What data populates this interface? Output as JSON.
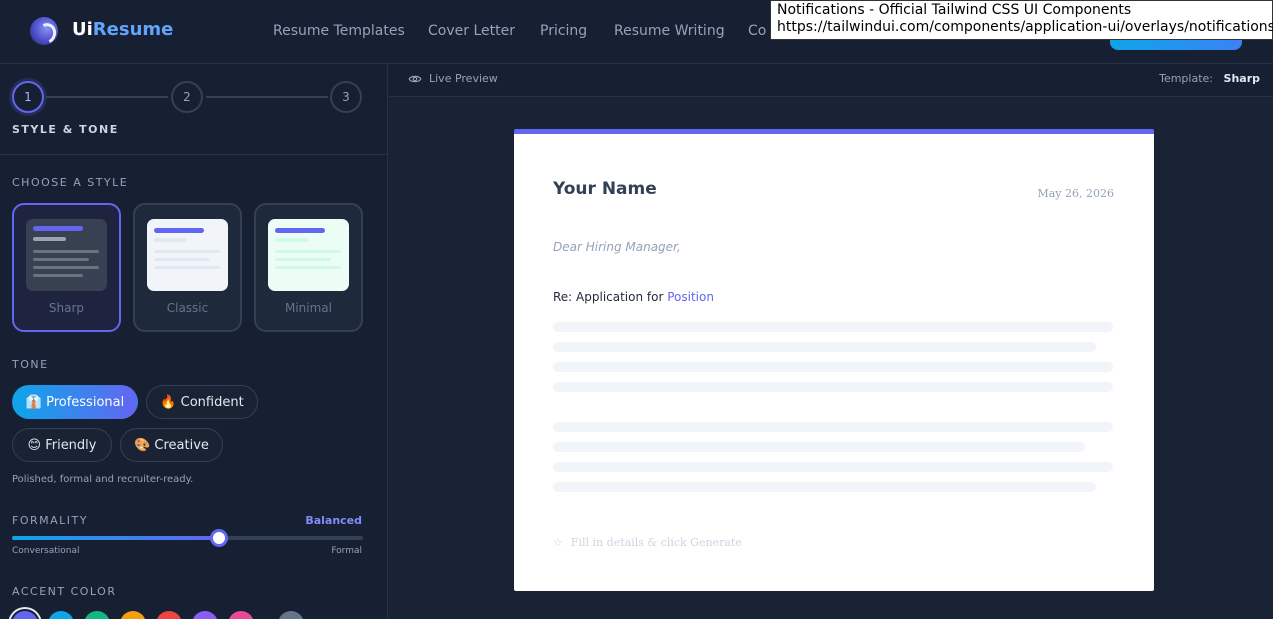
{
  "brand": {
    "part1": "Ui",
    "part2": "Resume"
  },
  "nav": {
    "links": [
      "Resume Templates",
      "Cover Letter",
      "Pricing",
      "Resume Writing",
      "Co"
    ]
  },
  "tooltip": {
    "title": "Notifications - Official Tailwind CSS UI Components",
    "url": "https://tailwindui.com/components/application-ui/overlays/notifications"
  },
  "steps": [
    "1",
    "2",
    "3"
  ],
  "step_title": "STYLE & TONE",
  "choose_style": {
    "label": "CHOOSE A STYLE",
    "options": [
      "Sharp",
      "Classic",
      "Minimal"
    ],
    "selected": "Sharp"
  },
  "tone": {
    "label": "TONE",
    "options": [
      "👔 Professional",
      "🔥 Confident",
      "😊 Friendly",
      "🎨 Creative"
    ],
    "selected": "👔 Professional",
    "description": "Polished, formal and recruiter-ready."
  },
  "formality": {
    "label": "FORMALITY",
    "value_label": "Balanced",
    "left": "Conversational",
    "right": "Formal",
    "level": 0.59
  },
  "accent": {
    "label": "ACCENT COLOR",
    "colors": [
      "#6366f1",
      "#0ea5e9",
      "#10b981",
      "#f59e0b",
      "#ef4444",
      "#8b5cf6",
      "#ec4899",
      "#64748b"
    ]
  },
  "preview": {
    "label": "Live Preview",
    "template_label": "Template:",
    "template_value": "Sharp"
  },
  "letter": {
    "name": "Your Name",
    "date": "May 26, 2026",
    "salutation": "Dear Hiring Manager,",
    "re_prefix": "Re: Application for ",
    "re_position": "Position",
    "hint": "Fill in details & click Generate"
  }
}
